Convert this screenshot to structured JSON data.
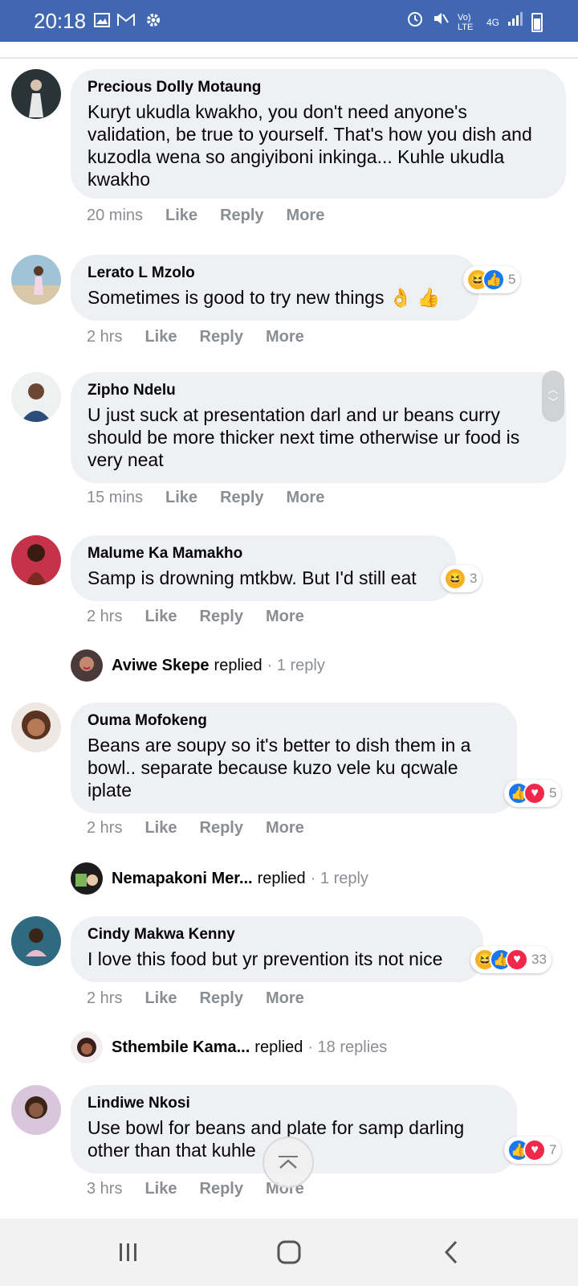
{
  "status_bar": {
    "time": "20:18",
    "left_icons": [
      "image-icon",
      "gmail-icon",
      "gear-icon"
    ],
    "right_icons": [
      "alarm-icon",
      "mute-icon",
      "volte-icon",
      "4g-icon",
      "signal-icon",
      "battery-icon"
    ],
    "volte_label": "Vo) LTE",
    "network_label": "4G"
  },
  "comments": [
    {
      "author": "Precious Dolly Motaung",
      "text": "Kuryt ukudla kwakho, you don't need anyone's validation, be true to yourself. That's how you dish and kuzodla wena so angiyiboni inkinga... Kuhle ukudla kwakho",
      "time": "20 mins",
      "like": "Like",
      "reply": "Reply",
      "more": "More"
    },
    {
      "author": "Lerato L Mzolo",
      "text": "Sometimes is good to try new things 👌 👍",
      "time": "2 hrs",
      "like": "Like",
      "reply": "Reply",
      "more": "More",
      "reaction_count": "5"
    },
    {
      "author": "Zipho Ndelu",
      "text": "U just suck at presentation darl and ur beans curry should be more thicker next time otherwise ur food is very neat",
      "time": "15 mins",
      "like": "Like",
      "reply": "Reply",
      "more": "More"
    },
    {
      "author": "Malume Ka Mamakho",
      "text": "Samp is drowning mtkbw. But I'd still eat",
      "time": "2 hrs",
      "like": "Like",
      "reply": "Reply",
      "more": "More",
      "reaction_count": "3",
      "replied_name": "Aviwe Skepe",
      "replied_verb": "replied",
      "replied_count": "· 1 reply"
    },
    {
      "author": "Ouma Mofokeng",
      "text": "Beans are soupy so it's better to dish them in a bowl.. separate because kuzo vele ku qcwale iplate",
      "time": "2 hrs",
      "like": "Like",
      "reply": "Reply",
      "more": "More",
      "reaction_count": "5",
      "replied_name": "Nemapakoni Mer...",
      "replied_verb": "replied",
      "replied_count": "· 1 reply"
    },
    {
      "author": "Cindy Makwa Kenny",
      "text": "I love this food but yr prevention its not nice",
      "time": "2 hrs",
      "like": "Like",
      "reply": "Reply",
      "more": "More",
      "reaction_count": "33",
      "replied_name": "Sthembile Kama...",
      "replied_verb": "replied",
      "replied_count": "· 18 replies"
    },
    {
      "author": "Lindiwe Nkosi",
      "text": "Use bowl for beans and plate for samp darling other than that kuhle",
      "time": "3 hrs",
      "like": "Like",
      "reply": "Reply",
      "more": "More",
      "reaction_count": "7"
    }
  ],
  "colors": {
    "header_blue": "#4267b2",
    "bubble_bg": "#eff0f3",
    "meta_gray": "#8a8d91",
    "like_blue": "#1877f2",
    "love_red": "#f0284a",
    "haha_yellow": "#f7b125"
  },
  "controls": {
    "scroll_top_icon": "chevron-up-icon",
    "nav_recent": "recent-apps-icon",
    "nav_home": "home-icon",
    "nav_back": "back-icon"
  }
}
